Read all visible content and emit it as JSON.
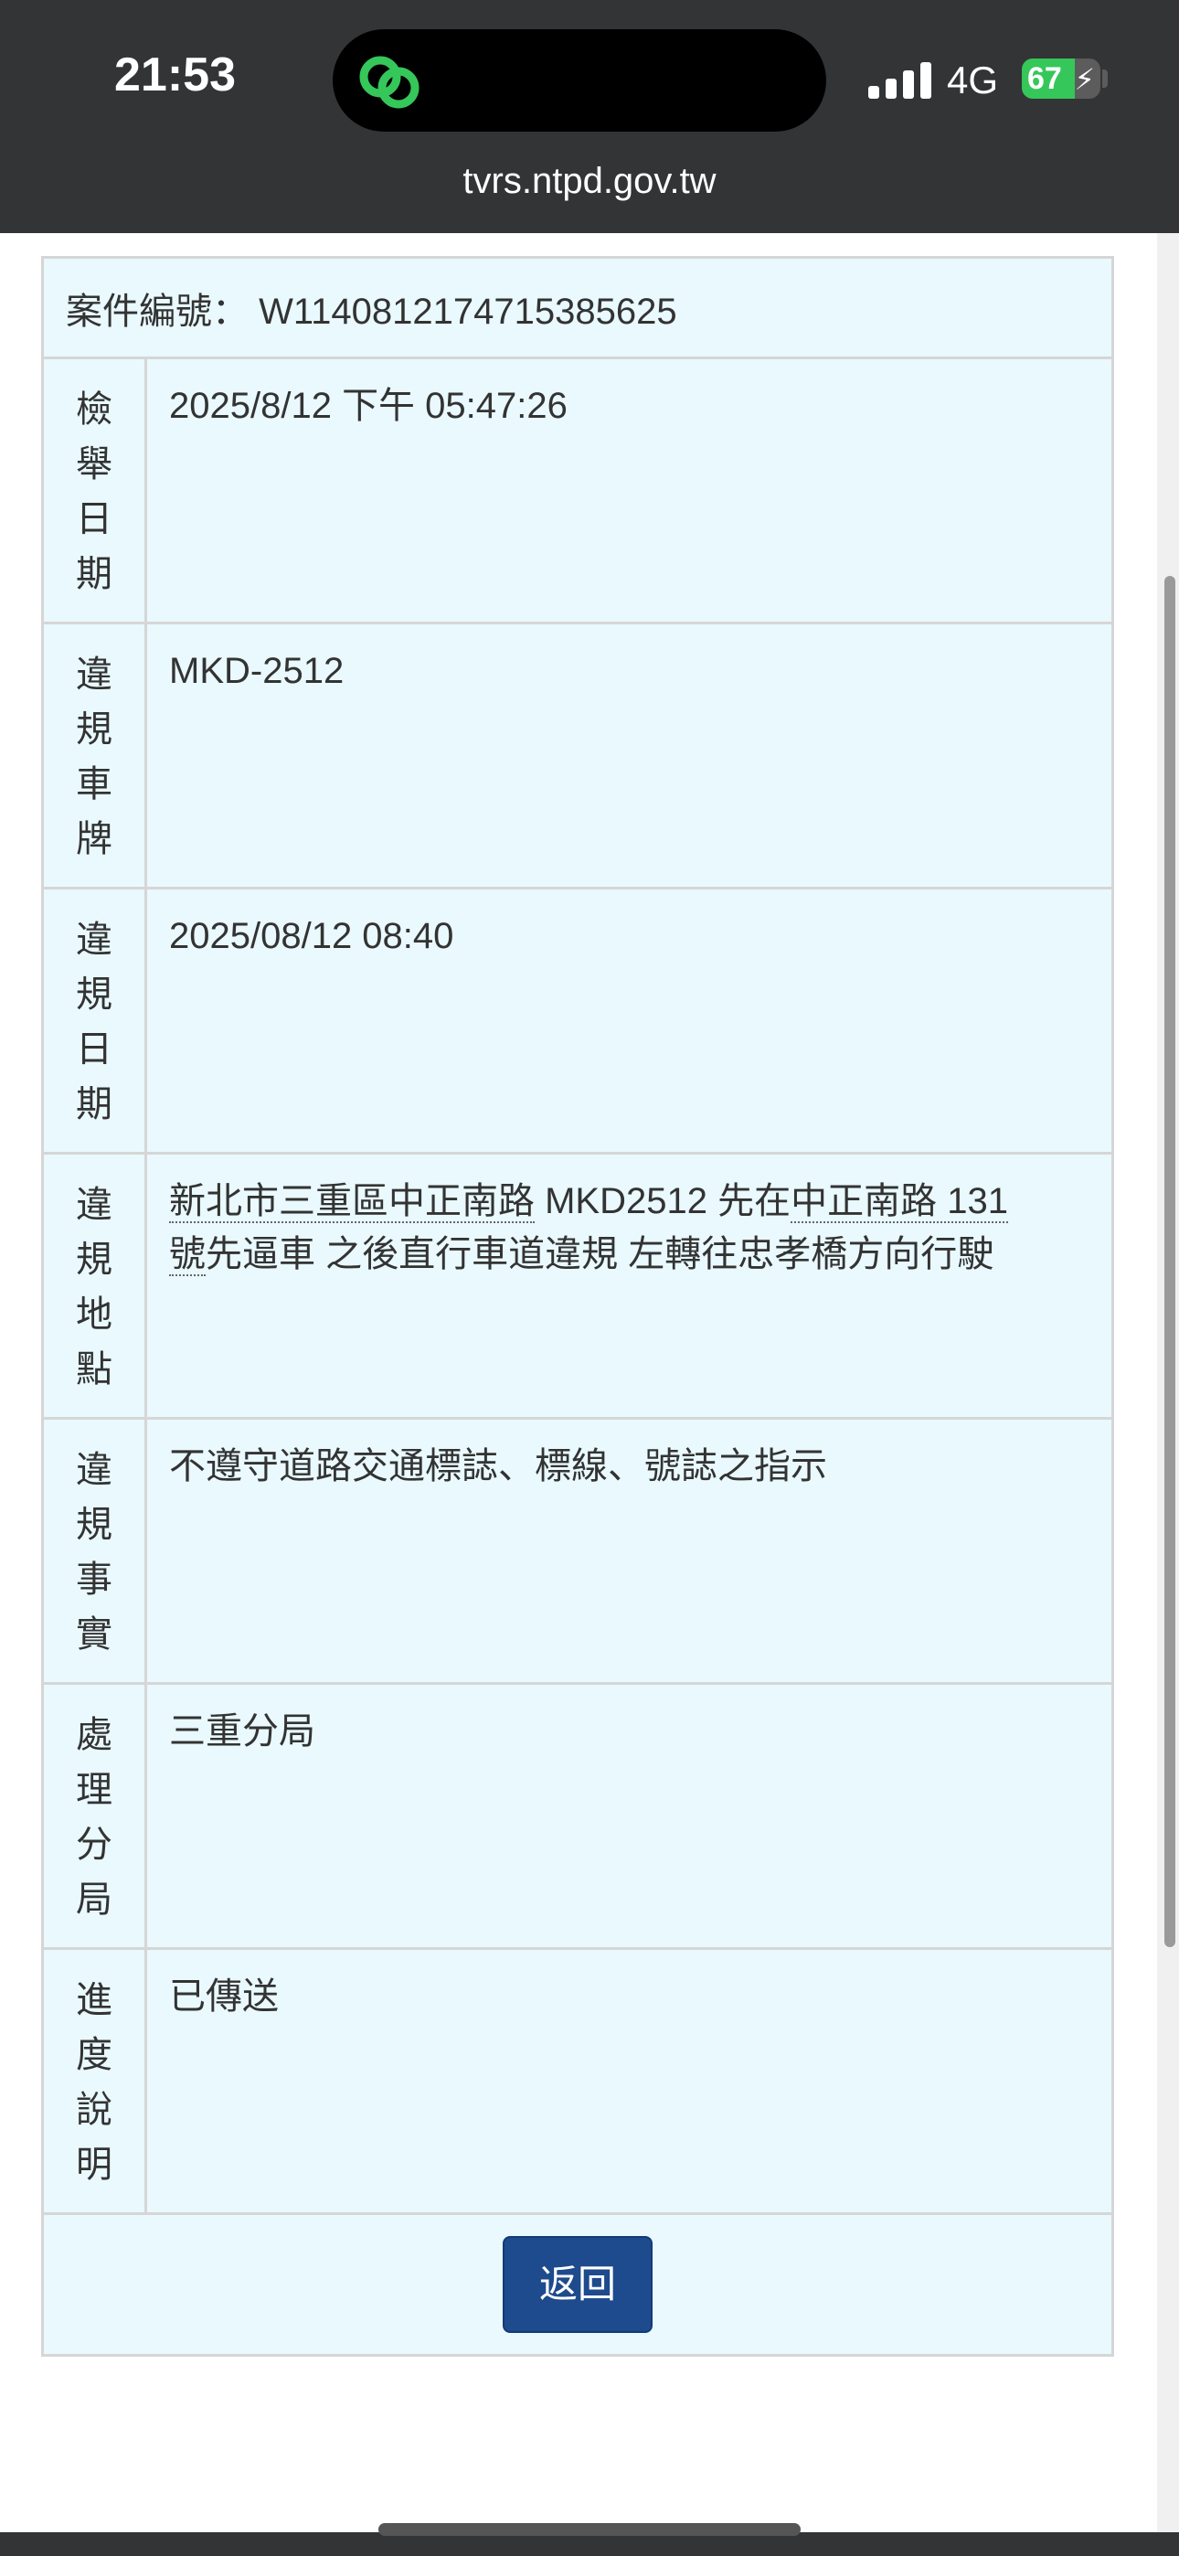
{
  "status_bar": {
    "time": "21:53",
    "network": "4G",
    "battery_level": "67",
    "battery_fraction": 0.67,
    "colors": {
      "bar": "#333436",
      "battery_fill": "#35c759"
    }
  },
  "url": "tvrs.ntpd.gov.tw",
  "case": {
    "label": "案件編號：",
    "number": "W1140812174715385625"
  },
  "rows": [
    {
      "label_chars": [
        "檢",
        "舉",
        "日",
        "期"
      ],
      "value": "2025/8/12 下午 05:47:26"
    },
    {
      "label_chars": [
        "違",
        "規",
        "車",
        "牌"
      ],
      "value": "MKD-2512"
    },
    {
      "label_chars": [
        "違",
        "規",
        "日",
        "期"
      ],
      "value": "2025/08/12 08:40"
    },
    {
      "label_chars": [
        "違",
        "規",
        "地",
        "點"
      ],
      "value_parts": [
        "新北市三重區中正南路",
        " MKD2512 先在",
        "中正南路 131",
        "號",
        "先逼車 之後直行車道違規 左轉往忠孝橋方向行駛"
      ]
    },
    {
      "label_chars": [
        "違",
        "規",
        "事",
        "實"
      ],
      "value": "不遵守道路交通標誌、標線、號誌之指示"
    },
    {
      "label_chars": [
        "處",
        "理",
        "分",
        "局"
      ],
      "value": "三重分局"
    },
    {
      "label_chars": [
        "進",
        "度",
        "說",
        "明"
      ],
      "value": "已傳送"
    }
  ],
  "back_button": "返回",
  "colors": {
    "table_bg": "#e9f9fe",
    "button_bg": "#1e4a8e",
    "border": "#d6d6d6"
  }
}
